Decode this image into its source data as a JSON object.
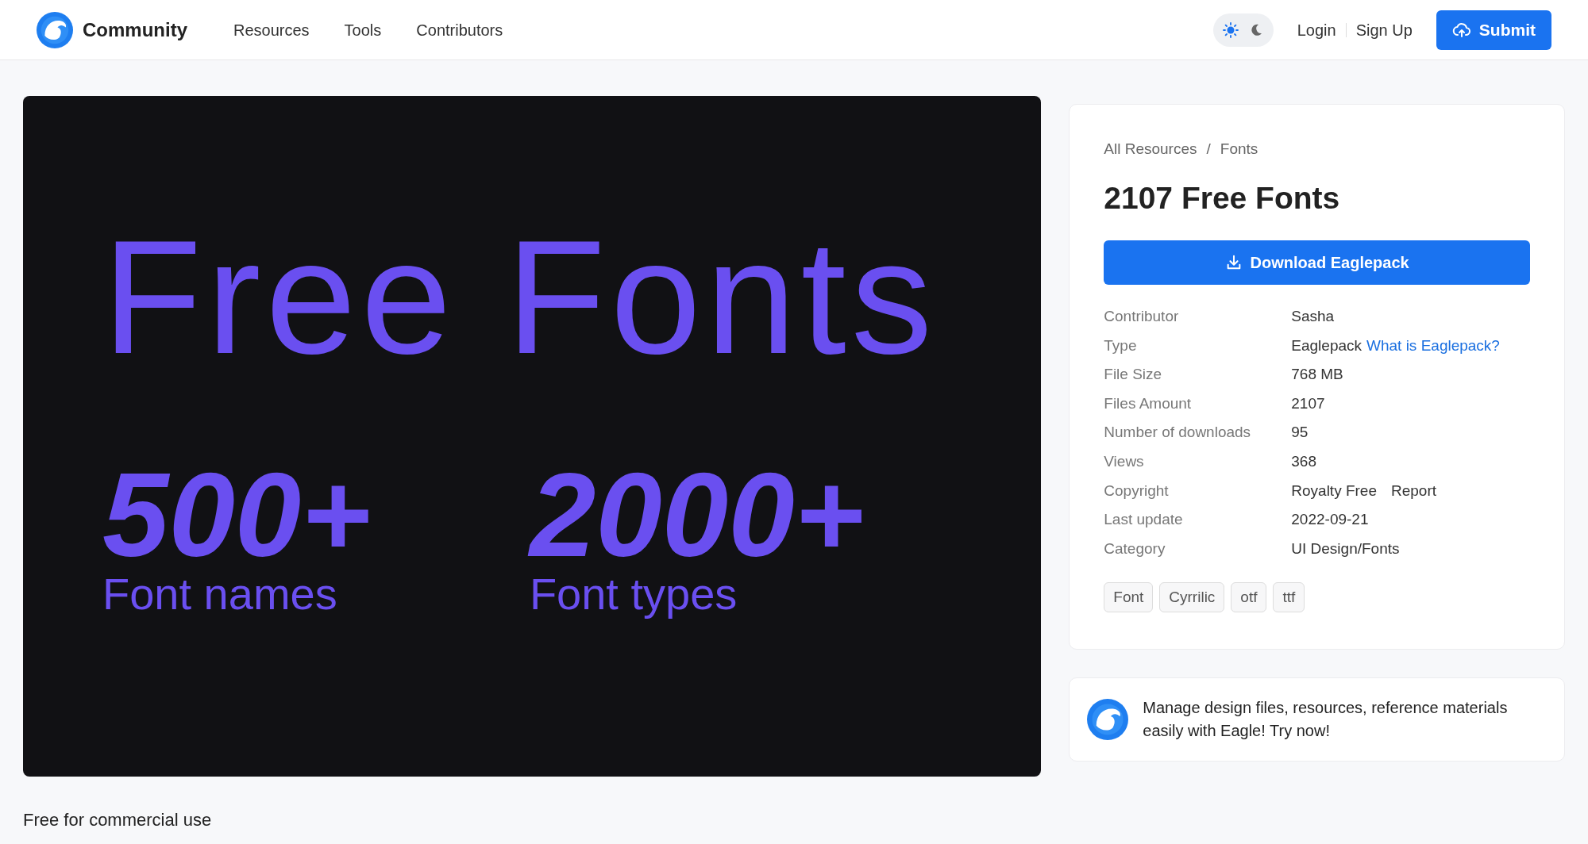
{
  "header": {
    "brand": "Community",
    "nav": [
      "Resources",
      "Tools",
      "Contributors"
    ],
    "theme_toggle": [
      {
        "kind": "sun",
        "selected": true
      },
      {
        "kind": "moon",
        "selected": false
      }
    ],
    "login": "Login",
    "signup": "Sign Up",
    "submit": "Submit"
  },
  "preview": {
    "title": "Free Fonts",
    "stats": [
      {
        "number": "500+",
        "label": "Font names"
      },
      {
        "number": "2000+",
        "label": "Font types"
      }
    ]
  },
  "details": {
    "breadcrumb": [
      "All Resources",
      "Fonts"
    ],
    "breadcrumb_separator": "/",
    "title": "2107 Free Fonts",
    "download": "Download Eaglepack",
    "rows": [
      {
        "label": "Contributor",
        "value": "Sasha"
      },
      {
        "label": "Type",
        "value": "Eaglepack",
        "link": "What is Eaglepack?"
      },
      {
        "label": "File Size",
        "value": "768 MB"
      },
      {
        "label": "Files Amount",
        "value": "2107"
      },
      {
        "label": "Number of downloads",
        "value": "95"
      },
      {
        "label": "Views",
        "value": "368"
      },
      {
        "label": "Copyright",
        "value": "Royalty Free",
        "action": "Report"
      },
      {
        "label": "Last update",
        "value": "2022-09-21"
      },
      {
        "label": "Category",
        "value": "UI Design/Fonts"
      }
    ],
    "tags": [
      "Font",
      "Cyrrilic",
      "otf",
      "ttf"
    ]
  },
  "promo": {
    "text": "Manage design files, resources, reference materials easily with Eagle! Try now!"
  },
  "description": "Free for commercial use"
}
